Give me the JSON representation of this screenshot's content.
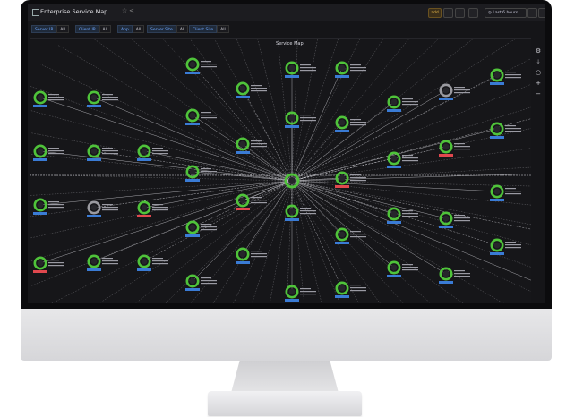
{
  "dashboard": {
    "title": "Enterprise Service Map",
    "panel_title": "Service Map",
    "time_range": "Last 6 hours",
    "add_label": "add"
  },
  "filters": [
    {
      "label": "Server IP",
      "value": "All"
    },
    {
      "label": "Client IP",
      "value": "All"
    },
    {
      "label": "App",
      "value": "All"
    },
    {
      "label": "Server Site",
      "value": "All"
    },
    {
      "label": "Client Site",
      "value": "All"
    }
  ],
  "colors": {
    "ok": "#4fc33a",
    "inactive": "#9a9aa0",
    "alert": "#e0484e",
    "label_blue": "#3a7bd5"
  },
  "icons": [
    "grid-icon",
    "star-icon",
    "share-icon",
    "save-icon",
    "settings-icon",
    "monitor-icon",
    "clock-icon",
    "zoom-icon",
    "collapse-icon",
    "cog-icon",
    "download-icon",
    "info-icon",
    "plus-icon",
    "minus-icon"
  ]
}
